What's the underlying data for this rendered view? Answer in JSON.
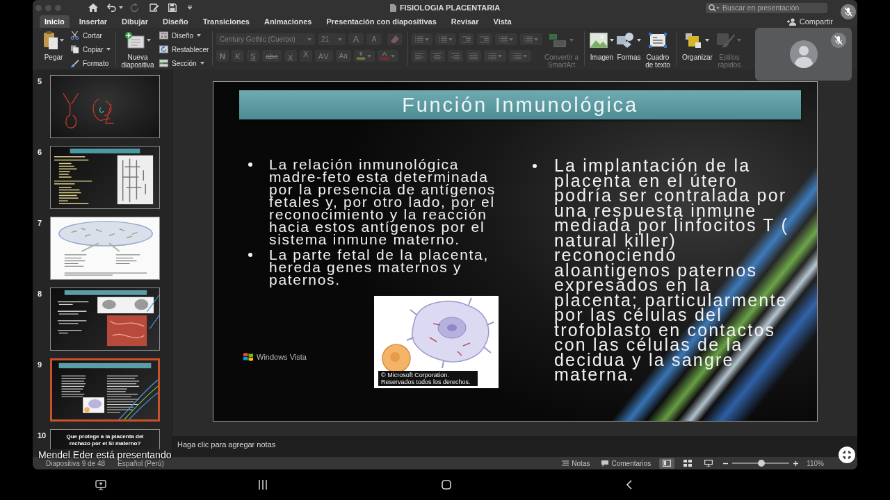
{
  "window": {
    "title": "FISIOLOGIA PLACENTARIA"
  },
  "search": {
    "placeholder": "Buscar en presentación"
  },
  "tabs": [
    {
      "label": "Inicio",
      "selected": true
    },
    {
      "label": "Insertar",
      "selected": false
    },
    {
      "label": "Dibujar",
      "selected": false
    },
    {
      "label": "Diseño",
      "selected": false
    },
    {
      "label": "Transiciones",
      "selected": false
    },
    {
      "label": "Animaciones",
      "selected": false
    },
    {
      "label": "Presentación con diapositivas",
      "selected": false
    },
    {
      "label": "Revisar",
      "selected": false
    },
    {
      "label": "Vista",
      "selected": false
    }
  ],
  "share_button": {
    "label": "Compartir"
  },
  "ribbon": {
    "paste": {
      "label": "Pegar",
      "dropdown": true
    },
    "clipboard": [
      {
        "kind": "cut",
        "label": "Cortar",
        "dropdown": false
      },
      {
        "kind": "copy",
        "label": "Copiar",
        "dropdown": true
      },
      {
        "kind": "format",
        "label": "Formato",
        "dropdown": false
      }
    ],
    "new_slide": {
      "label": "Nueva diapositiva",
      "dropdown": true
    },
    "slide_tools": [
      {
        "kind": "layout",
        "label": "Diseño",
        "dropdown": true
      },
      {
        "kind": "reset",
        "label": "Restablecer",
        "dropdown": false
      },
      {
        "kind": "section",
        "label": "Sección",
        "dropdown": true
      }
    ],
    "font": {
      "disabled": true,
      "font_name": "Century Gothic (Cuerpo)",
      "font_size": "21",
      "size_buttons": [
        {
          "kind": "grow",
          "label": "A"
        },
        {
          "kind": "shrink",
          "label": "A"
        }
      ],
      "style_buttons": [
        {
          "kind": "bold",
          "label": "N"
        },
        {
          "kind": "italic",
          "label": "K"
        },
        {
          "kind": "underline",
          "label": "S"
        },
        {
          "kind": "strikethrough",
          "label": "abc"
        },
        {
          "kind": "subscript",
          "label": "X"
        },
        {
          "kind": "superscript",
          "label": "X"
        },
        {
          "kind": "spacing",
          "label": "AV"
        },
        {
          "kind": "case",
          "label": "Aa"
        }
      ]
    },
    "paragraph": {
      "disabled": true
    },
    "large_buttons": [
      {
        "kind": "smartart",
        "label": "Convertir a SmartArt",
        "disabled": true,
        "dropdown": true
      },
      {
        "kind": "image",
        "label": "Imagen",
        "disabled": false,
        "dropdown": true
      },
      {
        "kind": "shapes",
        "label": "Formas",
        "disabled": false,
        "dropdown": true
      },
      {
        "kind": "textbox",
        "label": "Cuadro de texto",
        "disabled": false,
        "dropdown": false
      },
      {
        "kind": "arrange",
        "label": "Organizar",
        "disabled": false,
        "dropdown": true
      },
      {
        "kind": "styles",
        "label": "Estilos rápidos",
        "disabled": true,
        "dropdown": true
      }
    ]
  },
  "video_call": {
    "mic_muted": true,
    "tile_muted": true,
    "presenter_banner": "Mendel Eder está presentando"
  },
  "thumbnails": [
    {
      "number": "5",
      "selected": false,
      "kind": "sketch"
    },
    {
      "number": "6",
      "selected": false,
      "kind": "list"
    },
    {
      "number": "7",
      "selected": false,
      "kind": "figure"
    },
    {
      "number": "8",
      "selected": false,
      "kind": "split"
    },
    {
      "number": "9",
      "selected": true,
      "kind": "columns"
    },
    {
      "number": "10",
      "selected": false,
      "kind": "heading",
      "title": "Que protege a la placenta del rechazo por el SI materno?"
    }
  ],
  "slide": {
    "title": "Función Inmunológica",
    "left_bullets": [
      "La relación inmunológica madre-feto esta determinada por la presencia de antígenos fetales y, por otro lado, por el reconocimiento y la reacción hacia estos antígenos por el sistema inmune materno.",
      "La parte fetal de la placenta, hereda genes maternos y paternos."
    ],
    "right_bullets": [
      "La implantación de la placenta en el útero podría ser contralada por una respuesta inmune mediada por linfocitos T ( natural killer) reconociendo aloantigenos paternos expresados en la placenta; particularmente por las células del trofoblasto en contactos con las células de la decidua y la sangre materna."
    ],
    "logo_text": "Windows Vista",
    "image_caption": "© Microsoft Corporation. Reservados todos los derechos."
  },
  "notes": {
    "placeholder": "Haga clic para agregar notas"
  },
  "status_bar": {
    "slide_position": "Diapositiva 9 de 48",
    "language": "Español (Perú)",
    "notes_button": "Notas",
    "comments_button": "Comentarios",
    "views": [
      {
        "kind": "normal",
        "selected": true
      },
      {
        "kind": "sorter",
        "selected": false
      },
      {
        "kind": "presenter",
        "selected": false
      }
    ],
    "zoom": {
      "level": 0.51,
      "label": "110%"
    }
  }
}
